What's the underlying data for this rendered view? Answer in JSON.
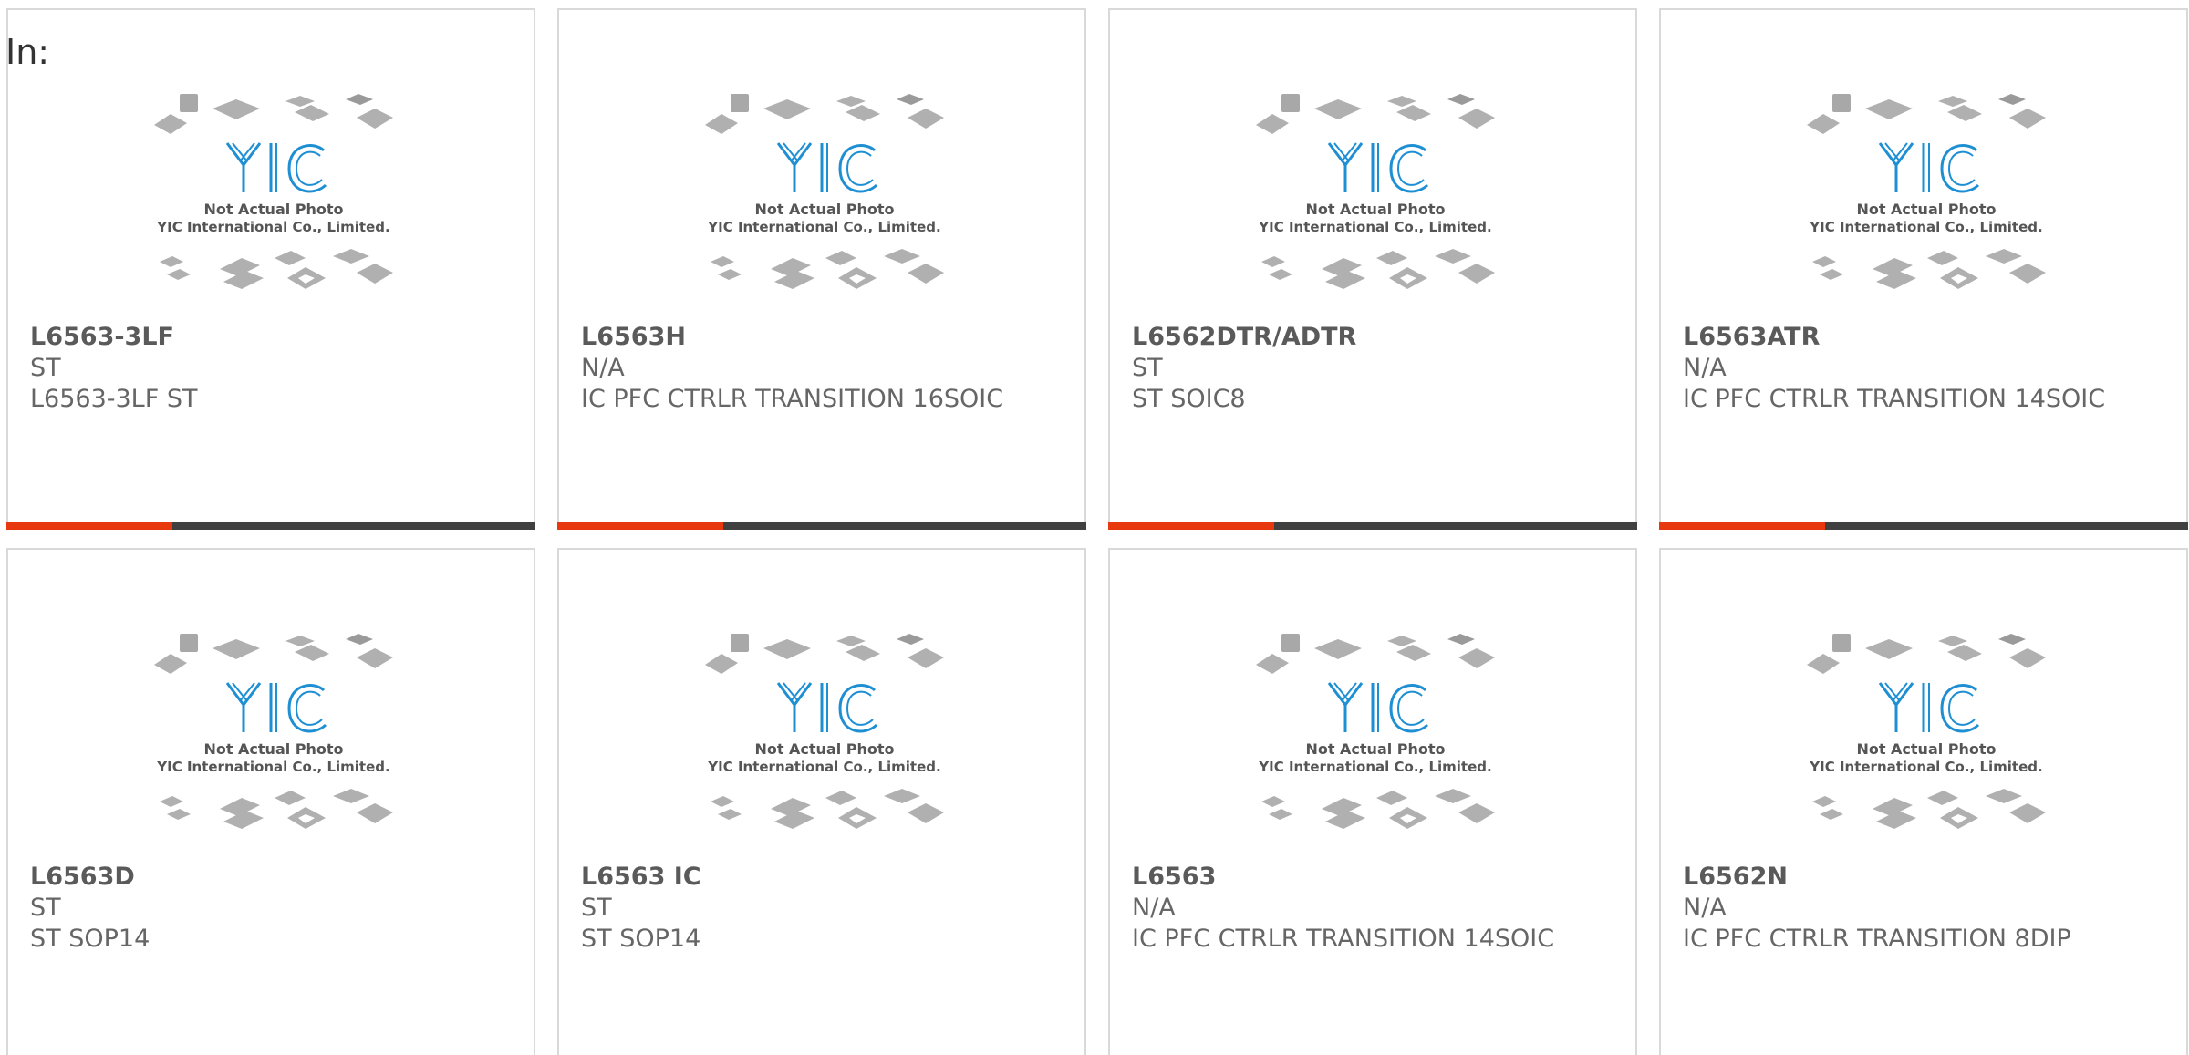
{
  "header": {
    "label": "In:"
  },
  "placeholder": {
    "line1": "Not Actual Photo",
    "line2": "YIC International Co., Limited.",
    "logo_text": "YIC",
    "logo_color": "#1f8fd3",
    "chip_color": "#b0b0b0"
  },
  "colors": {
    "accent": "#e8390e",
    "bar": "#404040",
    "text": "#666666",
    "border": "#d9d9d9"
  },
  "products": [
    {
      "part": "L6563-3LF",
      "manufacturer": "ST",
      "description": "L6563-3LF ST"
    },
    {
      "part": "L6563H",
      "manufacturer": "N/A",
      "description": "IC PFC CTRLR TRANSITION 16SOIC"
    },
    {
      "part": "L6562DTR/ADTR",
      "manufacturer": "ST",
      "description": "ST SOIC8"
    },
    {
      "part": "L6563ATR",
      "manufacturer": "N/A",
      "description": "IC PFC CTRLR TRANSITION 14SOIC"
    },
    {
      "part": "L6563D",
      "manufacturer": "ST",
      "description": "ST SOP14"
    },
    {
      "part": "L6563 IC",
      "manufacturer": "ST",
      "description": "ST SOP14"
    },
    {
      "part": "L6563",
      "manufacturer": "N/A",
      "description": "IC PFC CTRLR TRANSITION 14SOIC"
    },
    {
      "part": "L6562N",
      "manufacturer": "N/A",
      "description": "IC PFC CTRLR TRANSITION 8DIP"
    }
  ]
}
